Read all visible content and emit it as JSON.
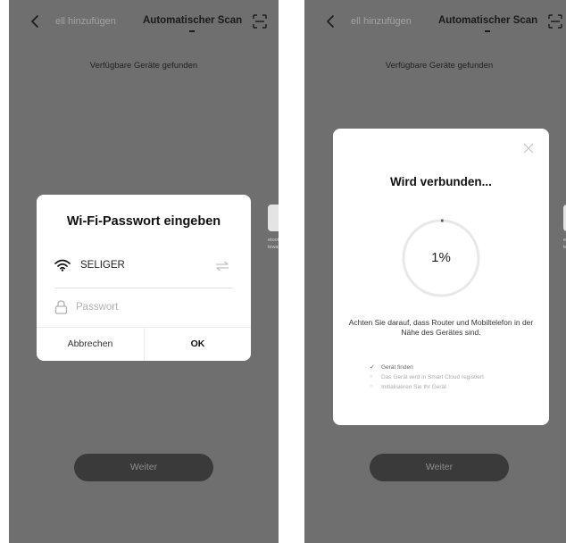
{
  "screens": [
    {
      "header": {
        "tab_add": "ell hinzufügen",
        "tab_scan": "Automatischer Scan"
      },
      "found_text": "Verfügbare Geräte gefunden",
      "peek_text": [
        "etooth",
        "teway"
      ],
      "dialog": {
        "title": "Wi-Fi-Passwort eingeben",
        "wifi_name": "SELIGER",
        "password_placeholder": "Passwort",
        "password_value": "",
        "cancel_label": "Abbrechen",
        "ok_label": "OK"
      },
      "weiter_label": "Weiter"
    },
    {
      "header": {
        "tab_add": "ell hinzufügen",
        "tab_scan": "Automatischer Scan"
      },
      "found_text": "Verfügbare Geräte gefunden",
      "peek_text": [
        "etooth",
        "teway"
      ],
      "dialog": {
        "title": "Wird verbunden...",
        "progress": 1,
        "progress_label": "1%",
        "hint": "Achten Sie darauf, dass Router und Mobiltelefon in der Nähe des Gerätes sind.",
        "steps": [
          {
            "label": "Gerät finden",
            "status": "done"
          },
          {
            "label": "Das Gerät wird in Smart Cloud registiert",
            "status": "pending"
          },
          {
            "label": "Initialisieren Sie Ihr Gerät",
            "status": "pending"
          }
        ]
      },
      "weiter_label": "Weiter"
    }
  ],
  "icons": {
    "back": "chevron-left-icon",
    "scan": "scan-frame-icon",
    "wifi": "wifi-icon",
    "swap": "swap-icon",
    "lock": "lock-icon",
    "close": "close-icon",
    "step_done": "checkmark-icon",
    "step_pending": "circle-icon"
  },
  "colors": {
    "overlay_background": "#6f6f6f",
    "dialog_background": "#ffffff",
    "button_background": "#3a3a3a",
    "progress_track": "#e8e8e8",
    "progress_fill": "#555555"
  }
}
